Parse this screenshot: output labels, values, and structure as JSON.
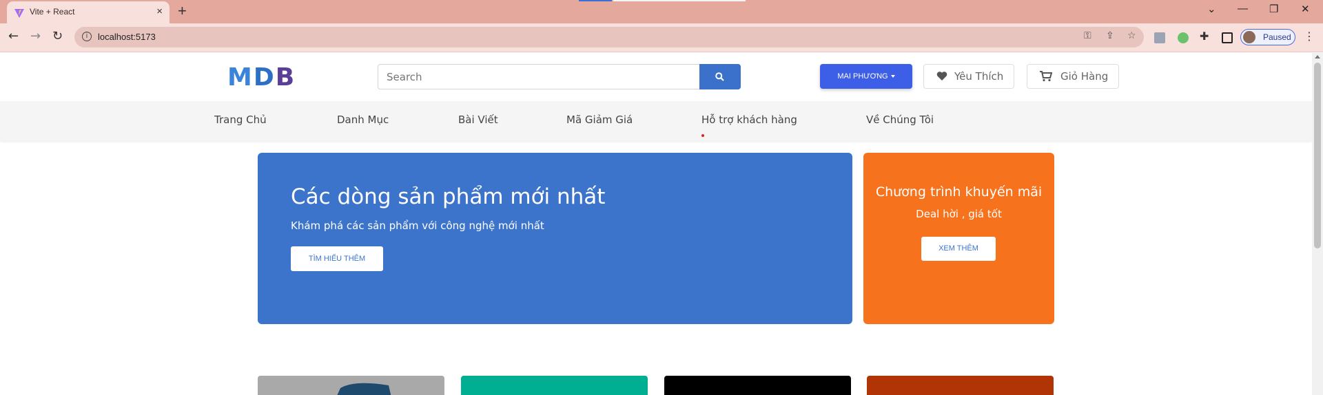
{
  "browser": {
    "tab_title": "Vite + React",
    "tab_close": "×",
    "new_tab": "+",
    "url": "localhost:5173",
    "profile_label": "Paused",
    "window_controls": {
      "chevron": "⌄",
      "minimize": "—",
      "restore": "❐",
      "close": "✕"
    }
  },
  "header": {
    "logo_letters": [
      "M",
      "D",
      "B"
    ],
    "search_placeholder": "Search",
    "user_button": "MAI PHƯƠNG",
    "wishlist_label": "Yêu Thích",
    "cart_label": "Giỏ Hàng"
  },
  "nav": {
    "items": [
      "Trang Chủ",
      "Danh Mục",
      "Bài Viết",
      "Mã Giảm Giá",
      "Hỗ trợ khách hàng",
      "Về Chúng Tôi"
    ]
  },
  "hero": {
    "title": "Các dòng sản phẩm mới nhất",
    "subtitle": "Khám phá các sản phẩm với công nghệ mới nhất",
    "button": "TÌM HIỂU THÊM"
  },
  "promo": {
    "title": "Chương trình khuyến mãi",
    "subtitle": "Deal hời , giá tốt",
    "button": "XEM THÊM"
  },
  "colors": {
    "hero_bg": "#3c74cc",
    "promo_bg": "#f6721d",
    "primary_button": "#3d5fe8",
    "search_button": "#3b71ca",
    "card_colors": [
      "#a9a9a9",
      "#00af91",
      "#000000",
      "#b03406"
    ]
  },
  "icons": {
    "search": "search-icon",
    "heart": "heart-icon",
    "cart": "cart-icon",
    "caret": "caret-down-icon"
  }
}
